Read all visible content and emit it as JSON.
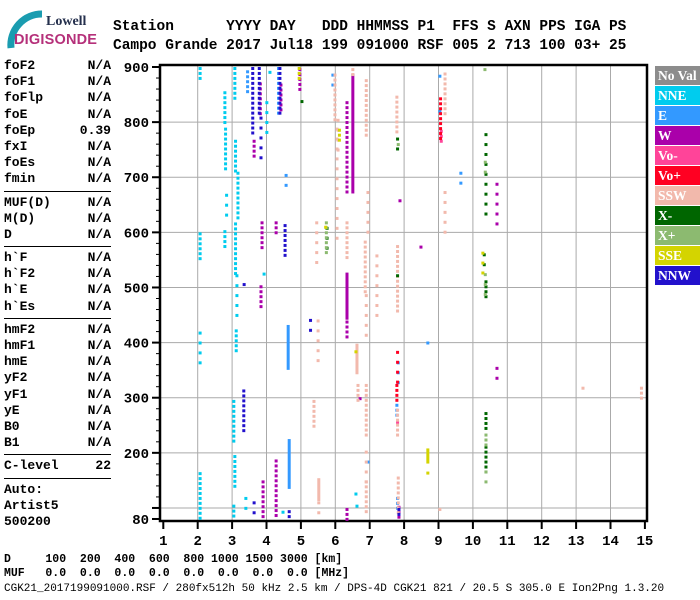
{
  "logo": {
    "line1": "Lowell",
    "line2": "DIGISONDE"
  },
  "header": {
    "line1": "Station      YYYY DAY   DDD HHMMSS P1  FFS S AXN PPS IGA PS",
    "line2": "Campo Grande 2017 Jul18 199 091000 RSF 005 2 713 100 03+ 25"
  },
  "sidebar": {
    "groups": [
      [
        {
          "label": "foF2",
          "value": "N/A"
        },
        {
          "label": "foF1",
          "value": "N/A"
        },
        {
          "label": "foFlp",
          "value": "N/A"
        },
        {
          "label": "foE",
          "value": "N/A"
        },
        {
          "label": "foEp",
          "value": "0.39"
        },
        {
          "label": "fxI",
          "value": "N/A"
        },
        {
          "label": "foEs",
          "value": "N/A"
        },
        {
          "label": "fmin",
          "value": "N/A"
        }
      ],
      [
        {
          "label": "MUF(D)",
          "value": "N/A"
        },
        {
          "label": "M(D)",
          "value": "N/A"
        },
        {
          "label": "D",
          "value": "N/A"
        }
      ],
      [
        {
          "label": "h`F",
          "value": "N/A"
        },
        {
          "label": "h`F2",
          "value": "N/A"
        },
        {
          "label": "h`E",
          "value": "N/A"
        },
        {
          "label": "h`Es",
          "value": "N/A"
        }
      ],
      [
        {
          "label": "hmF2",
          "value": "N/A"
        },
        {
          "label": "hmF1",
          "value": "N/A"
        },
        {
          "label": "hmE",
          "value": "N/A"
        },
        {
          "label": "yF2",
          "value": "N/A"
        },
        {
          "label": "yF1",
          "value": "N/A"
        },
        {
          "label": "yE",
          "value": "N/A"
        },
        {
          "label": "B0",
          "value": "N/A"
        },
        {
          "label": "B1",
          "value": "N/A"
        }
      ],
      [
        {
          "label": "C-level",
          "value": "22"
        }
      ]
    ],
    "auto_lines": [
      "Auto:",
      "Artist5",
      "500200"
    ]
  },
  "legend": {
    "items": [
      {
        "key": "NV",
        "label": "No Val"
      },
      {
        "key": "NNE",
        "label": "NNE"
      },
      {
        "key": "E",
        "label": "E"
      },
      {
        "key": "W",
        "label": "W"
      },
      {
        "key": "VOM",
        "label": "Vo-"
      },
      {
        "key": "VOP",
        "label": "Vo+"
      },
      {
        "key": "SSW",
        "label": "SSW"
      },
      {
        "key": "XM",
        "label": "X-"
      },
      {
        "key": "XP",
        "label": "X+"
      },
      {
        "key": "SSE",
        "label": "SSE"
      },
      {
        "key": "NNW",
        "label": "NNW"
      }
    ]
  },
  "chart_data": {
    "type": "scatter",
    "title": "Digisonde skymap-coded ionogram, Campo Grande 2017-07-18 09:10:00",
    "xlabel": "[MHz]",
    "ylabel": "[km]",
    "x_range": [
      1,
      15
    ],
    "y_range": [
      80,
      900
    ],
    "grid": true,
    "grid_color": "#aaaaaa",
    "axes": {
      "x_tick_labels": [
        1,
        2,
        3,
        4,
        5,
        6,
        7,
        8,
        9,
        10,
        11,
        12,
        13,
        14,
        15
      ],
      "y_tick_labels": [
        900,
        800,
        700,
        600,
        500,
        400,
        300,
        200,
        80
      ],
      "y_minor_step_km": 20
    },
    "colors": {
      "NV": "#8c8c8c",
      "NNE": "#00ccee",
      "E": "#3399ff",
      "W": "#aa00aa",
      "VOM": "#ff4499",
      "VOP": "#ff0022",
      "SSW": "#f2b9ac",
      "XM": "#006600",
      "XP": "#8cba70",
      "SSE": "#d4d400",
      "NNW": "#2211cc"
    },
    "segment_format": [
      "direction_key",
      "freq_MHz",
      "height_top_km",
      "height_bottom_km",
      "style: s=solid d=dotted x=sparse 1=single"
    ],
    "segments": [
      [
        "NNE",
        2.07,
        900,
        876,
        "d"
      ],
      [
        "NNE",
        2.07,
        600,
        552,
        "d"
      ],
      [
        "NNE",
        2.07,
        420,
        355,
        "x"
      ],
      [
        "NNE",
        2.07,
        165,
        82,
        "d"
      ],
      [
        "NNE",
        2.79,
        856,
        798,
        "d"
      ],
      [
        "NNE",
        2.81,
        790,
        712,
        "d"
      ],
      [
        "NNE",
        2.84,
        670,
        618,
        "x"
      ],
      [
        "NNE",
        2.79,
        604,
        575,
        "d"
      ],
      [
        "NNE",
        3.08,
        900,
        846,
        "d"
      ],
      [
        "NNE",
        3.1,
        768,
        712,
        "d"
      ],
      [
        "NNE",
        3.17,
        710,
        622,
        "d"
      ],
      [
        "NNE",
        3.1,
        618,
        525,
        "d"
      ],
      [
        "NNE",
        3.14,
        524,
        448,
        "x"
      ],
      [
        "NNE",
        3.12,
        424,
        382,
        "d"
      ],
      [
        "NNE",
        3.05,
        296,
        222,
        "d"
      ],
      [
        "NNE",
        3.08,
        196,
        140,
        "d"
      ],
      [
        "NNE",
        3.05,
        106,
        82,
        "d"
      ],
      [
        "NNE",
        3.4,
        120,
        90,
        "x"
      ],
      [
        "NNE",
        3.93,
        527,
        512,
        "x"
      ],
      [
        "NNE",
        4.01,
        838,
        772,
        "x"
      ],
      [
        "NNE",
        4.1,
        893,
        893,
        "1"
      ],
      [
        "NNE",
        4.48,
        95,
        95,
        "1"
      ],
      [
        "NNE",
        6.6,
        128,
        120,
        "x"
      ],
      [
        "NNE",
        6.63,
        106,
        94,
        "x"
      ],
      [
        "E",
        3.45,
        894,
        856,
        "d"
      ],
      [
        "E",
        4.35,
        900,
        814,
        "d"
      ],
      [
        "E",
        4.57,
        706,
        672,
        "x"
      ],
      [
        "E",
        4.63,
        432,
        356,
        "s"
      ],
      [
        "E",
        4.66,
        225,
        140,
        "s"
      ],
      [
        "E",
        5.93,
        888,
        870,
        "x"
      ],
      [
        "E",
        6.95,
        186,
        182,
        "1"
      ],
      [
        "E",
        7.83,
        366,
        322,
        "x"
      ],
      [
        "E",
        7.79,
        289,
        265,
        "d"
      ],
      [
        "E",
        7.81,
        120,
        96,
        "d"
      ],
      [
        "E",
        8.69,
        402,
        398,
        "1"
      ],
      [
        "E",
        9.04,
        886,
        886,
        "1"
      ],
      [
        "E",
        9.04,
        822,
        822,
        "1"
      ],
      [
        "E",
        9.65,
        710,
        680,
        "x"
      ],
      [
        "W",
        3.64,
        768,
        740,
        "d"
      ],
      [
        "W",
        3.82,
        872,
        818,
        "d"
      ],
      [
        "W",
        3.87,
        620,
        574,
        "d"
      ],
      [
        "W",
        3.84,
        504,
        460,
        "d"
      ],
      [
        "W",
        3.9,
        150,
        82,
        "d"
      ],
      [
        "W",
        4.28,
        620,
        600,
        "d"
      ],
      [
        "W",
        4.28,
        188,
        82,
        "d"
      ],
      [
        "W",
        4.42,
        870,
        818,
        "d"
      ],
      [
        "W",
        4.97,
        898,
        856,
        "d"
      ],
      [
        "W",
        6.34,
        838,
        672,
        "d"
      ],
      [
        "W",
        6.34,
        527,
        447,
        "s"
      ],
      [
        "W",
        6.34,
        440,
        412,
        "d"
      ],
      [
        "W",
        6.34,
        100,
        82,
        "d"
      ],
      [
        "W",
        6.51,
        888,
        676,
        "s"
      ],
      [
        "W",
        6.72,
        301,
        301,
        "1"
      ],
      [
        "W",
        7.85,
        104,
        82,
        "d"
      ],
      [
        "W",
        7.88,
        660,
        660,
        "1"
      ],
      [
        "W",
        8.49,
        576,
        576,
        "1"
      ],
      [
        "W",
        10.7,
        690,
        608,
        "x"
      ],
      [
        "W",
        10.7,
        356,
        338,
        "x"
      ],
      [
        "VOM",
        9.08,
        786,
        762,
        "d"
      ],
      [
        "VOM",
        7.81,
        258,
        258,
        "1"
      ],
      [
        "VOP",
        9.06,
        845,
        766,
        "d"
      ],
      [
        "VOP",
        7.79,
        325,
        290,
        "d"
      ],
      [
        "VOP",
        7.81,
        385,
        330,
        "x"
      ],
      [
        "SSW",
        5.38,
        296,
        250,
        "d"
      ],
      [
        "SSW",
        5.46,
        620,
        548,
        "x"
      ],
      [
        "SSW",
        5.5,
        442,
        364,
        "x"
      ],
      [
        "SSW",
        5.52,
        154,
        118,
        "s"
      ],
      [
        "SSW",
        5.52,
        112,
        85,
        "x"
      ],
      [
        "SSW",
        5.99,
        888,
        800,
        "d"
      ],
      [
        "SSW",
        6.05,
        790,
        590,
        "x"
      ],
      [
        "SSW",
        6.08,
        806,
        740,
        "x"
      ],
      [
        "SSW",
        6.34,
        620,
        552,
        "d"
      ],
      [
        "SSW",
        6.51,
        898,
        888,
        "d"
      ],
      [
        "SSW",
        6.63,
        398,
        348,
        "s"
      ],
      [
        "SSW",
        6.66,
        325,
        290,
        "d"
      ],
      [
        "SSW",
        6.9,
        878,
        772,
        "d"
      ],
      [
        "SSW",
        6.95,
        675,
        590,
        "x"
      ],
      [
        "SSW",
        6.87,
        585,
        490,
        "d"
      ],
      [
        "SSW",
        6.9,
        488,
        412,
        "x"
      ],
      [
        "SSW",
        6.9,
        325,
        230,
        "d"
      ],
      [
        "SSW",
        6.9,
        204,
        150,
        "x"
      ],
      [
        "SSW",
        6.9,
        150,
        88,
        "d"
      ],
      [
        "SSW",
        7.21,
        560,
        440,
        "x"
      ],
      [
        "SSW",
        7.79,
        848,
        780,
        "d"
      ],
      [
        "SSW",
        7.81,
        577,
        454,
        "d"
      ],
      [
        "SSW",
        7.81,
        280,
        230,
        "d"
      ],
      [
        "SSW",
        7.83,
        157,
        88,
        "d"
      ],
      [
        "SSW",
        9.04,
        100,
        85,
        "x"
      ],
      [
        "SSW",
        9.19,
        890,
        814,
        "d"
      ],
      [
        "SSW",
        9.19,
        675,
        586,
        "x"
      ],
      [
        "SSW",
        13.2,
        320,
        320,
        "1"
      ],
      [
        "SSW",
        14.9,
        320,
        300,
        "d"
      ],
      [
        "XM",
        5.03,
        840,
        840,
        "1"
      ],
      [
        "XM",
        5.76,
        610,
        560,
        "x"
      ],
      [
        "XM",
        7.81,
        772,
        752,
        "x"
      ],
      [
        "XM",
        7.81,
        524,
        524,
        "1"
      ],
      [
        "XM",
        10.38,
        780,
        620,
        "x"
      ],
      [
        "XM",
        10.33,
        562,
        540,
        "x"
      ],
      [
        "XM",
        10.38,
        513,
        478,
        "d"
      ],
      [
        "XM",
        10.38,
        274,
        246,
        "d"
      ],
      [
        "XM",
        10.38,
        213,
        168,
        "d"
      ],
      [
        "XP",
        5.74,
        620,
        566,
        "d"
      ],
      [
        "XP",
        7.83,
        762,
        762,
        "1"
      ],
      [
        "XP",
        10.35,
        898,
        898,
        "1"
      ],
      [
        "XP",
        10.36,
        730,
        700,
        "x"
      ],
      [
        "XP",
        10.36,
        526,
        474,
        "x"
      ],
      [
        "XP",
        10.38,
        235,
        213,
        "d"
      ],
      [
        "XP",
        10.38,
        168,
        150,
        "x"
      ],
      [
        "SSE",
        4.95,
        900,
        880,
        "d"
      ],
      [
        "SSE",
        5.72,
        612,
        612,
        "1"
      ],
      [
        "SSE",
        6.12,
        788,
        770,
        "d"
      ],
      [
        "SSE",
        6.6,
        386,
        386,
        "1"
      ],
      [
        "SSE",
        8.69,
        208,
        186,
        "s"
      ],
      [
        "SSE",
        8.69,
        166,
        166,
        "1"
      ],
      [
        "SSE",
        10.29,
        565,
        520,
        "x"
      ],
      [
        "NNW",
        3.6,
        900,
        776,
        "d"
      ],
      [
        "NNW",
        3.79,
        900,
        812,
        "d"
      ],
      [
        "NNW",
        3.84,
        810,
        722,
        "x"
      ],
      [
        "NNW",
        3.64,
        112,
        94,
        "x"
      ],
      [
        "NNW",
        3.34,
        315,
        238,
        "d"
      ],
      [
        "NNW",
        3.35,
        508,
        508,
        "1"
      ],
      [
        "NNW",
        4.39,
        900,
        816,
        "d"
      ],
      [
        "NNW",
        4.54,
        615,
        556,
        "d"
      ],
      [
        "NNW",
        4.66,
        96,
        84,
        "d"
      ],
      [
        "NNW",
        5.28,
        443,
        423,
        "x"
      ],
      [
        "NNW",
        7.85,
        100,
        88,
        "d"
      ]
    ]
  },
  "footer": {
    "d_row": "D     100  200  400  600  800 1000 1500 3000 [km]",
    "muf_row": "MUF   0.0  0.0  0.0  0.0  0.0  0.0  0.0  0.0 [MHz]",
    "status": "CGK21_2017199091000.RSF / 280fx512h 50 kHz 2.5 km / DPS-4D CGK21 821 / 20.5 S 305.0 E Ion2Png 1.3.20"
  }
}
